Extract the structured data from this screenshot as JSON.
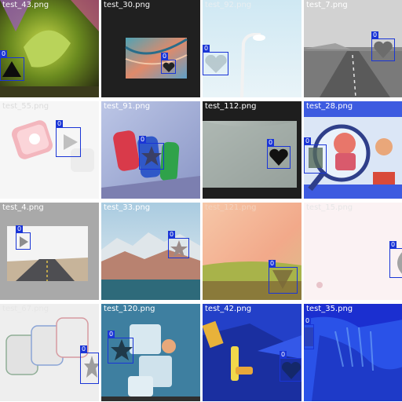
{
  "tiles": [
    {
      "filename": "test_43.png",
      "label_color": "#f5f5f5",
      "detection": {
        "class_id": "0"
      }
    },
    {
      "filename": "test_30.png",
      "label_color": "#f5f5f5",
      "detection": {
        "class_id": "0"
      }
    },
    {
      "filename": "test_92.png",
      "label_color": "#e8eef2",
      "detection": {
        "class_id": "0"
      }
    },
    {
      "filename": "test_7.png",
      "label_color": "#ffffff",
      "detection": {
        "class_id": "0"
      }
    },
    {
      "filename": "test_55.png",
      "label_color": "#dcdcdc",
      "detection": {
        "class_id": "0"
      }
    },
    {
      "filename": "test_91.png",
      "label_color": "#ffffff",
      "detection": {
        "class_id": "0"
      }
    },
    {
      "filename": "test_112.png",
      "label_color": "#ffffff",
      "detection": {
        "class_id": "0"
      }
    },
    {
      "filename": "test_28.png",
      "label_color": "#ffffff",
      "detection": {
        "class_id": "0"
      }
    },
    {
      "filename": "test_4.png",
      "label_color": "#ffffff",
      "detection": {
        "class_id": "0"
      }
    },
    {
      "filename": "test_33.png",
      "label_color": "#ffffff",
      "detection": {
        "class_id": "0"
      }
    },
    {
      "filename": "test_121.png",
      "label_color": "#f3d2bd",
      "detection": {
        "class_id": "0"
      }
    },
    {
      "filename": "test_15.png",
      "label_color": "#e6e6e6",
      "detection": {
        "class_id": "0"
      }
    },
    {
      "filename": "test_67.png",
      "label_color": "#e6e6e6",
      "detection": {
        "class_id": "0"
      }
    },
    {
      "filename": "test_120.png",
      "label_color": "#ffffff",
      "detection": {
        "class_id": "0"
      }
    },
    {
      "filename": "test_42.png",
      "label_color": "#ffffff",
      "detection": {
        "class_id": "0"
      }
    },
    {
      "filename": "test_35.png",
      "label_color": "#ffffff",
      "detection": {
        "class_id": "0"
      }
    }
  ],
  "accent": "#1a35d6"
}
